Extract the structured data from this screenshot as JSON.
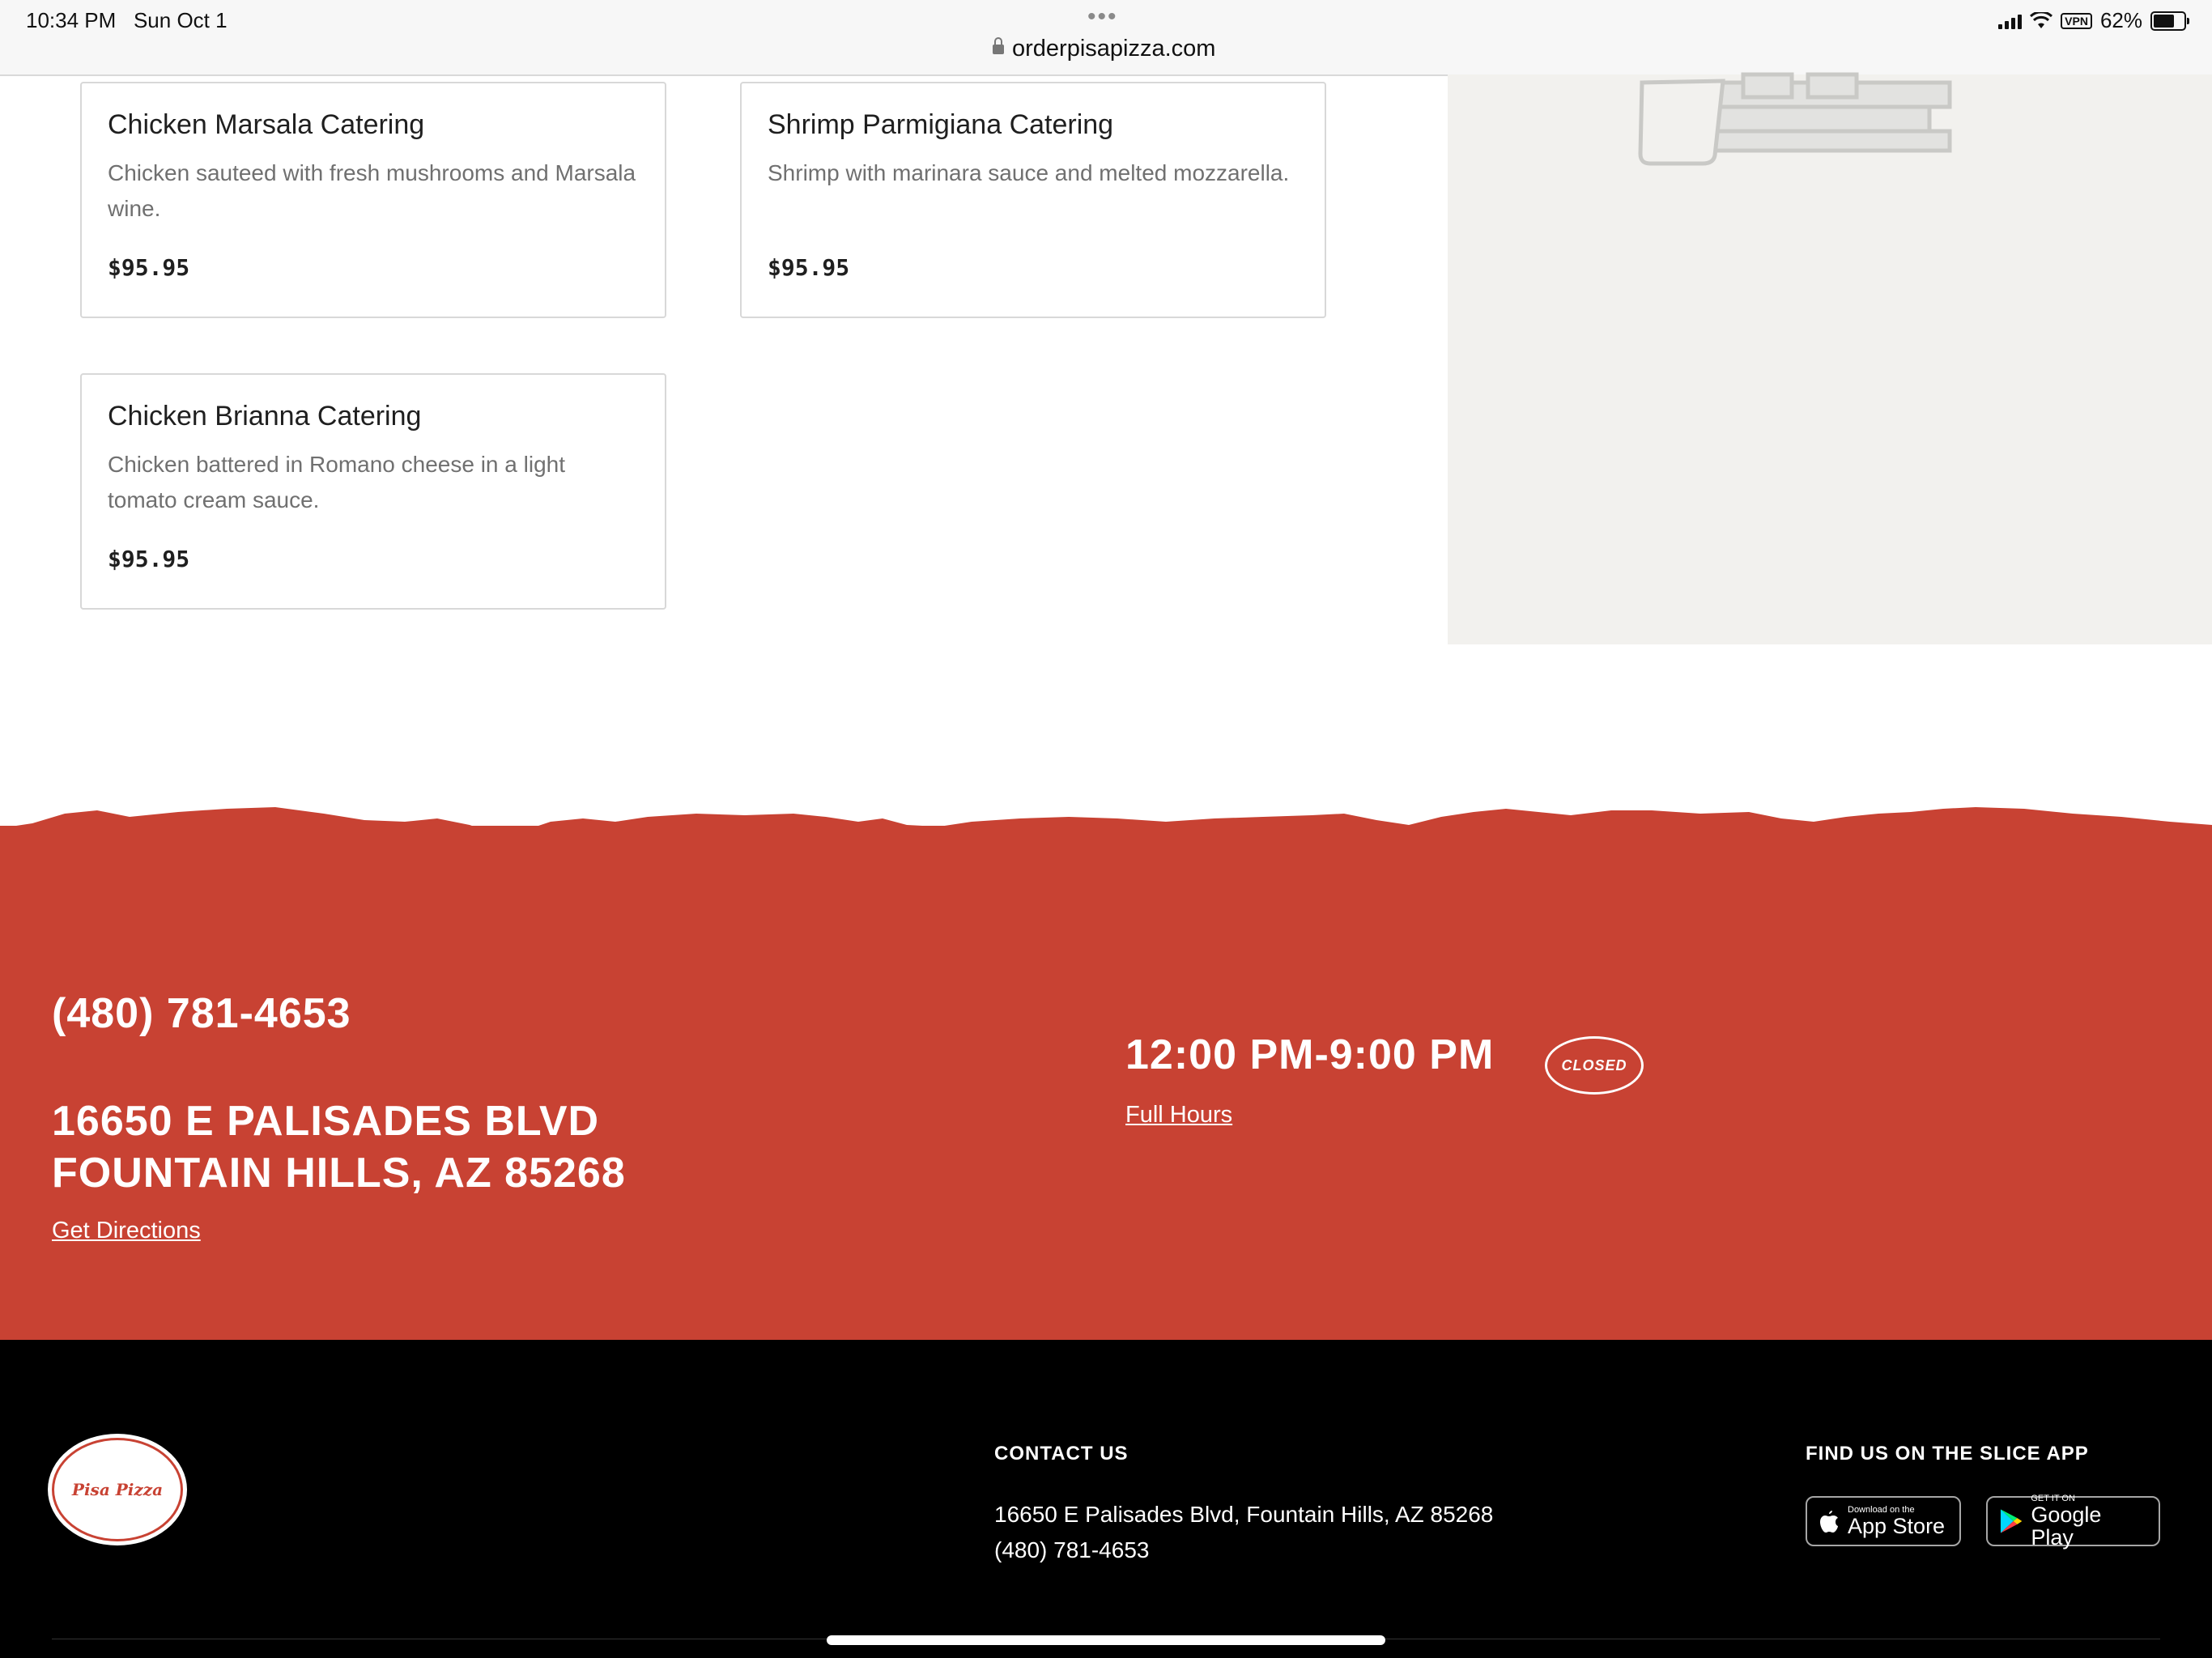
{
  "status_bar": {
    "time": "10:34 PM",
    "date": "Sun Oct 1",
    "url": "orderpisapizza.com",
    "vpn": "VPN",
    "battery": "62%"
  },
  "menu_items": [
    {
      "title": "Chicken Marsala Catering",
      "description": "Chicken sauteed with fresh mushrooms and Marsala wine.",
      "price": "$95.95"
    },
    {
      "title": "Shrimp Parmigiana Catering",
      "description": "Shrimp with marinara sauce and melted mozzarella.",
      "price": "$95.95"
    },
    {
      "title": "Chicken Brianna Catering",
      "description": "Chicken battered in Romano cheese in a light tomato cream sauce.",
      "price": "$95.95"
    }
  ],
  "info": {
    "phone": "(480) 781-4653",
    "address_line1": "16650 E PALISADES BLVD",
    "address_line2": "FOUNTAIN HILLS, AZ 85268",
    "directions_link": "Get Directions",
    "hours": "12:00 PM-9:00 PM",
    "status": "CLOSED",
    "full_hours_link": "Full Hours"
  },
  "footer": {
    "logo_text": "Pisa Pizza",
    "contact_heading": "CONTACT US",
    "contact_address": "16650 E Palisades Blvd, Fountain Hills, AZ 85268",
    "contact_phone": "(480) 781-4653",
    "app_heading": "FIND US ON THE SLICE APP",
    "app_store_small": "Download on the",
    "app_store_big": "App Store",
    "google_small": "GET IT ON",
    "google_big": "Google Play"
  },
  "colors": {
    "brand_red": "#c84233",
    "footer_bg": "#000000",
    "map_bg": "#f2f1ee"
  }
}
